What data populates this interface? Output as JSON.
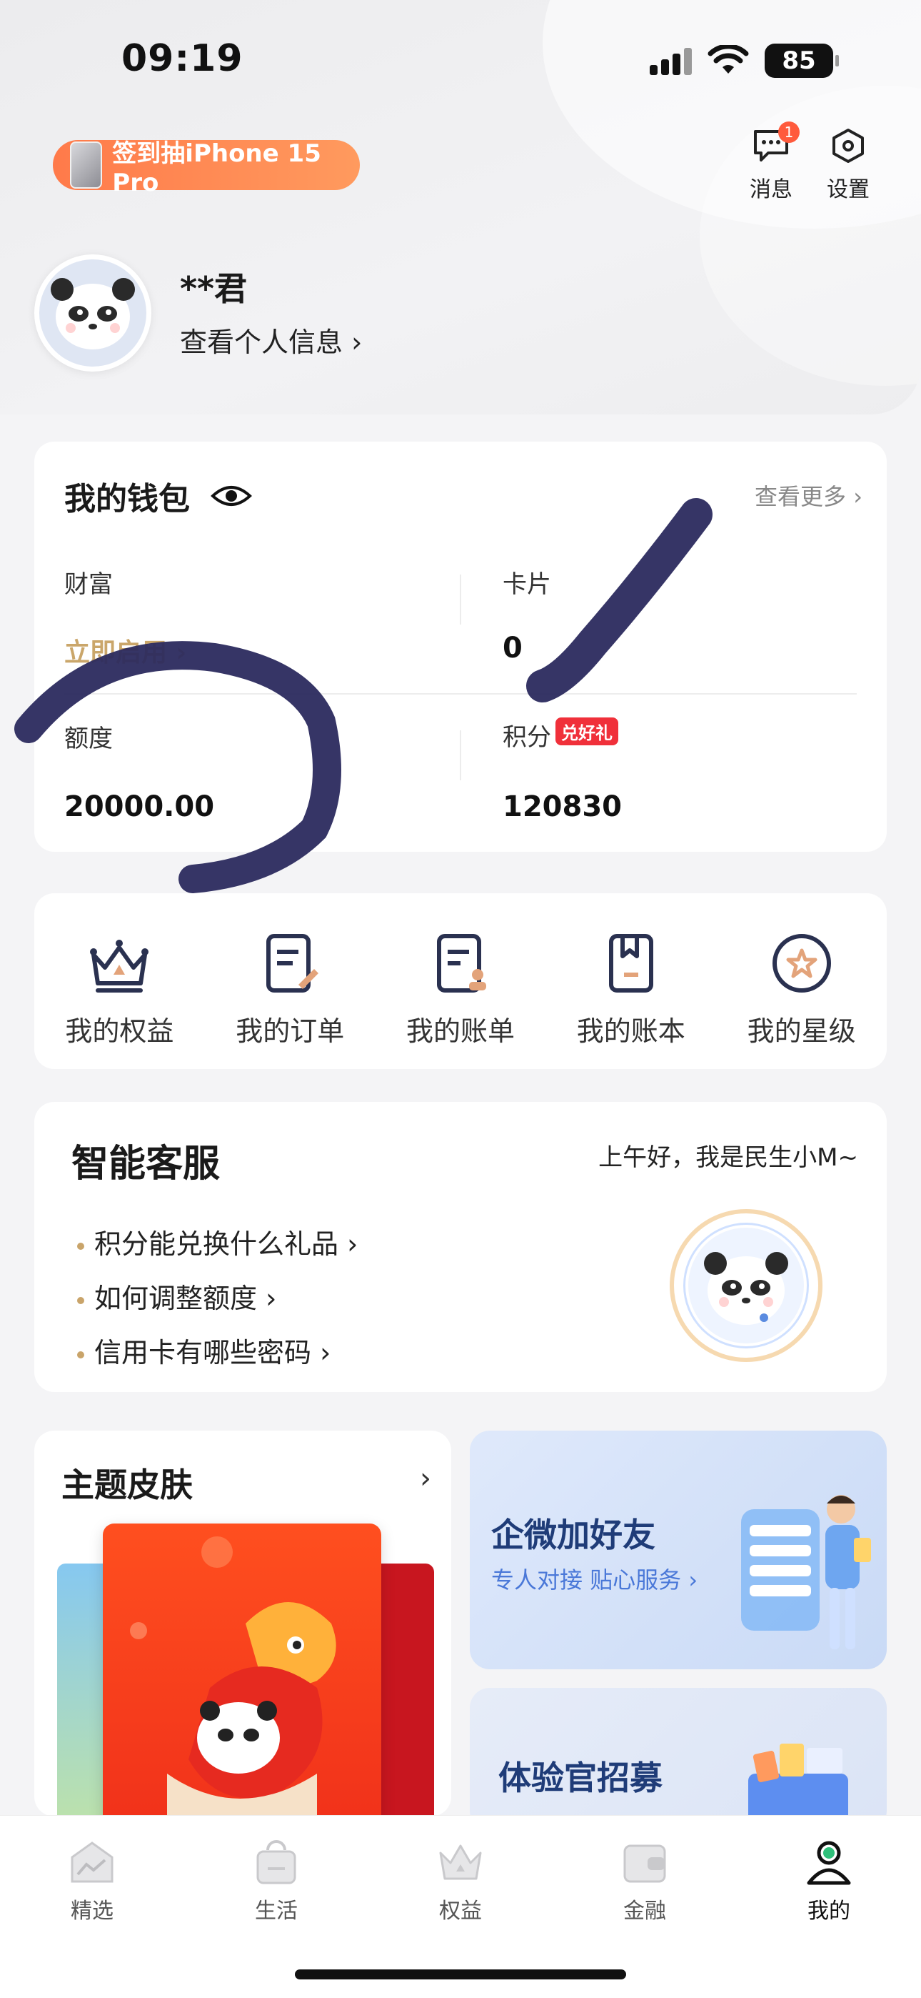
{
  "status_bar": {
    "time": "09:19",
    "battery": "85"
  },
  "promo": {
    "label": "签到抽iPhone 15 Pro"
  },
  "top_actions": {
    "messages": {
      "label": "消息",
      "badge": "1"
    },
    "settings": {
      "label": "设置"
    }
  },
  "profile": {
    "name": "**君",
    "link": "查看个人信息 ›"
  },
  "wallet": {
    "title": "我的钱包",
    "more": "查看更多 ›",
    "wealth": {
      "label": "财富",
      "value": "立即启用"
    },
    "cards": {
      "label": "卡片",
      "value": "0"
    },
    "limit": {
      "label": "额度",
      "value": "20000.00"
    },
    "points": {
      "label": "积分",
      "badge": "兑好礼",
      "value": "120830"
    }
  },
  "shortcuts": [
    {
      "label": "我的权益",
      "icon": "crown-icon"
    },
    {
      "label": "我的订单",
      "icon": "order-icon"
    },
    {
      "label": "我的账单",
      "icon": "bill-icon"
    },
    {
      "label": "我的账本",
      "icon": "ledger-icon"
    },
    {
      "label": "我的星级",
      "icon": "star-level-icon"
    }
  ],
  "service": {
    "title": "智能客服",
    "greeting": "上午好，我是民生小M~",
    "questions": [
      "积分能兑换什么礼品 ›",
      "如何调整额度 ›",
      "信用卡有哪些密码 ›"
    ]
  },
  "theme": {
    "title": "主题皮肤"
  },
  "promo_cards": {
    "wechat": {
      "title": "企微加好友",
      "subtitle": "专人对接 贴心服务 ›"
    },
    "recruit": {
      "title": "体验官招募"
    }
  },
  "tabbar": [
    {
      "label": "精选"
    },
    {
      "label": "生活"
    },
    {
      "label": "权益"
    },
    {
      "label": "金融"
    },
    {
      "label": "我的"
    }
  ],
  "colors": {
    "accent_gold": "#caa66a",
    "scribble": "#2b2a5e",
    "promo_orange": "#ff7a4a",
    "badge_red": "#f0303a"
  }
}
